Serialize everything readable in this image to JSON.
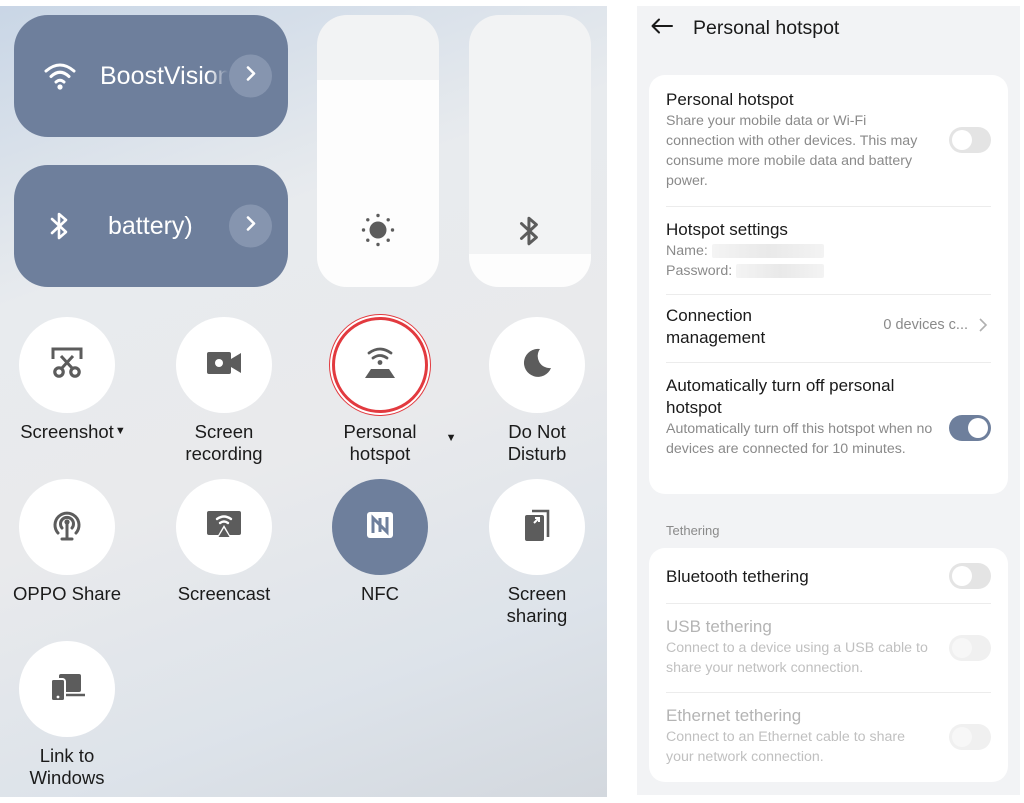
{
  "quick_settings": {
    "wifi_tile": {
      "icon": "wifi-icon",
      "label": "BoostVision",
      "active": true
    },
    "bluetooth_tile": {
      "icon": "bluetooth-icon",
      "label": "(… battery)",
      "visible_label": "battery)",
      "active": true
    },
    "brightness_slider": {
      "icon": "brightness-icon",
      "level_percent": 76
    },
    "volume_slider": {
      "icon": "bluetooth-icon",
      "level_percent": 12
    },
    "buttons": [
      {
        "label": "Screenshot",
        "icon": "screenshot-scissors-icon",
        "has_dropdown": true,
        "active": false
      },
      {
        "label": "Screen recording",
        "icon": "video-camera-icon",
        "has_dropdown": false,
        "active": false
      },
      {
        "label": "Personal hotspot",
        "icon": "hotspot-icon",
        "has_dropdown": true,
        "active": false,
        "highlighted": true
      },
      {
        "label": "Do Not Disturb",
        "icon": "moon-icon",
        "has_dropdown": true,
        "active": false
      },
      {
        "label": "OPPO Share",
        "icon": "oppo-share-icon",
        "has_dropdown": false,
        "active": false
      },
      {
        "label": "Screencast",
        "icon": "screencast-icon",
        "has_dropdown": false,
        "active": false
      },
      {
        "label": "NFC",
        "icon": "nfc-icon",
        "has_dropdown": false,
        "active": true
      },
      {
        "label": "Screen sharing",
        "icon": "screen-sharing-icon",
        "has_dropdown": false,
        "active": false
      },
      {
        "label": "Link to Windows",
        "icon": "link-to-windows-icon",
        "has_dropdown": false,
        "active": false
      }
    ],
    "label_lines": {
      "screenshot": [
        "Screenshot"
      ],
      "screen_recording": [
        "Screen",
        "recording"
      ],
      "personal_hotspot": [
        "Personal",
        "hotspot"
      ],
      "do_not_disturb": [
        "Do Not",
        "Disturb"
      ],
      "oppo_share": [
        "OPPO Share"
      ],
      "screencast": [
        "Screencast"
      ],
      "nfc": [
        "NFC"
      ],
      "screen_sharing": [
        "Screen",
        "sharing"
      ],
      "link_to_windows": [
        "Link to",
        "Windows"
      ]
    },
    "colors": {
      "active_tile": "#6e7f9c",
      "highlight_ring": "#e23a3f"
    }
  },
  "settings": {
    "page_title": "Personal hotspot",
    "back_icon": "back-arrow-icon",
    "hotspot": {
      "title": "Personal hotspot",
      "description": "Share your mobile data or Wi-Fi connection with other devices. This may consume more mobile data and battery power.",
      "enabled": false
    },
    "hotspot_settings": {
      "title": "Hotspot settings",
      "name_label": "Name:",
      "password_label": "Password:"
    },
    "connection_management": {
      "title": "Connection management",
      "value": "0 devices c..."
    },
    "auto_off": {
      "title": "Automatically turn off personal hotspot",
      "description": "Automatically turn off this hotspot when no devices are connected for 10 minutes.",
      "enabled": true
    },
    "tethering_header": "Tethering",
    "tethering": [
      {
        "title": "Bluetooth tethering",
        "description": "",
        "enabled": false,
        "disabled": false
      },
      {
        "title": "USB tethering",
        "description": "Connect to a device using a USB cable to share your network connection.",
        "enabled": false,
        "disabled": true
      },
      {
        "title": "Ethernet tethering",
        "description": "Connect to an Ethernet cable to share your network connection.",
        "enabled": false,
        "disabled": true
      }
    ],
    "colors": {
      "toggle_on": "#6e7f9c",
      "toggle_off": "#e4e4e4"
    }
  }
}
